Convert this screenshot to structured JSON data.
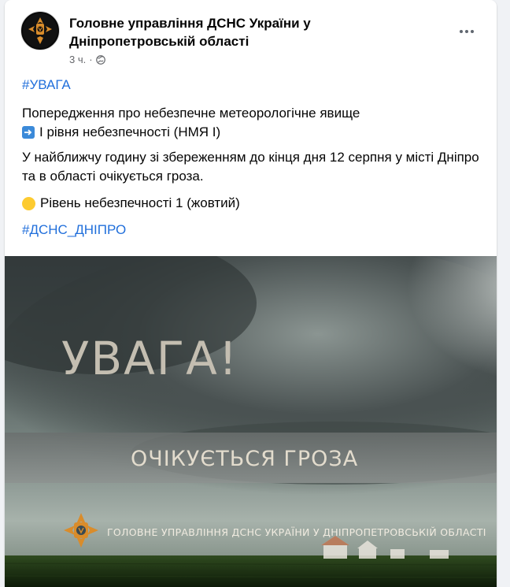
{
  "page": {
    "name": "Головне управління ДСНС України у Дніпропетровській області",
    "time": "3 ч.",
    "separator": "·",
    "privacy_icon": "globe-icon",
    "more_icon": "more-options-icon"
  },
  "post": {
    "hashtag_top": "#УВАГА",
    "line1": "Попередження про небезпечне метеорологічне явище",
    "line2_emoji": "arrow-right-emoji",
    "line2": "І рівня небезпечності (НМЯ І)",
    "line3": "У найближчу годину зі збереженням до кінця дня 12 серпня у місті Дніпро та в області очікується гроза.",
    "line4_emoji": "yellow-circle-emoji",
    "line4": "Рівень небезпечності 1 (жовтий)",
    "hashtag_bottom": "#ДСНС_ДНІПРО"
  },
  "image": {
    "headline": "УВАГА!",
    "banner": "ОЧІКУЄТЬСЯ ГРОЗА",
    "org_line": "ГОЛОВНЕ УПРАВЛІННЯ ДСНС УКРАЇНИ У ДНІПРОПЕТРОВСЬКІЙ ОБЛАСТІ",
    "logo_text": "ГОЛОВНЕ УПРАВЛІННЯ ДСНС УКРАЇНИ",
    "accent_color": "#d98c2b",
    "link_color": "#216fdb"
  }
}
